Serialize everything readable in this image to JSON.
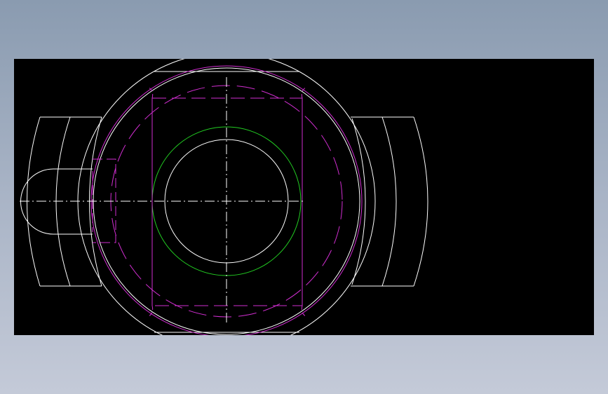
{
  "viewer": {
    "background": "#000000",
    "frame_background": "#9aa7bb"
  },
  "drawing": {
    "colors": {
      "outline": "#ffffff",
      "hidden": "#d12ed1",
      "center": "#ffffff",
      "thread": "#22cc22"
    },
    "layers": [
      "outline",
      "hidden-lines",
      "center-lines",
      "bore-circle"
    ]
  }
}
